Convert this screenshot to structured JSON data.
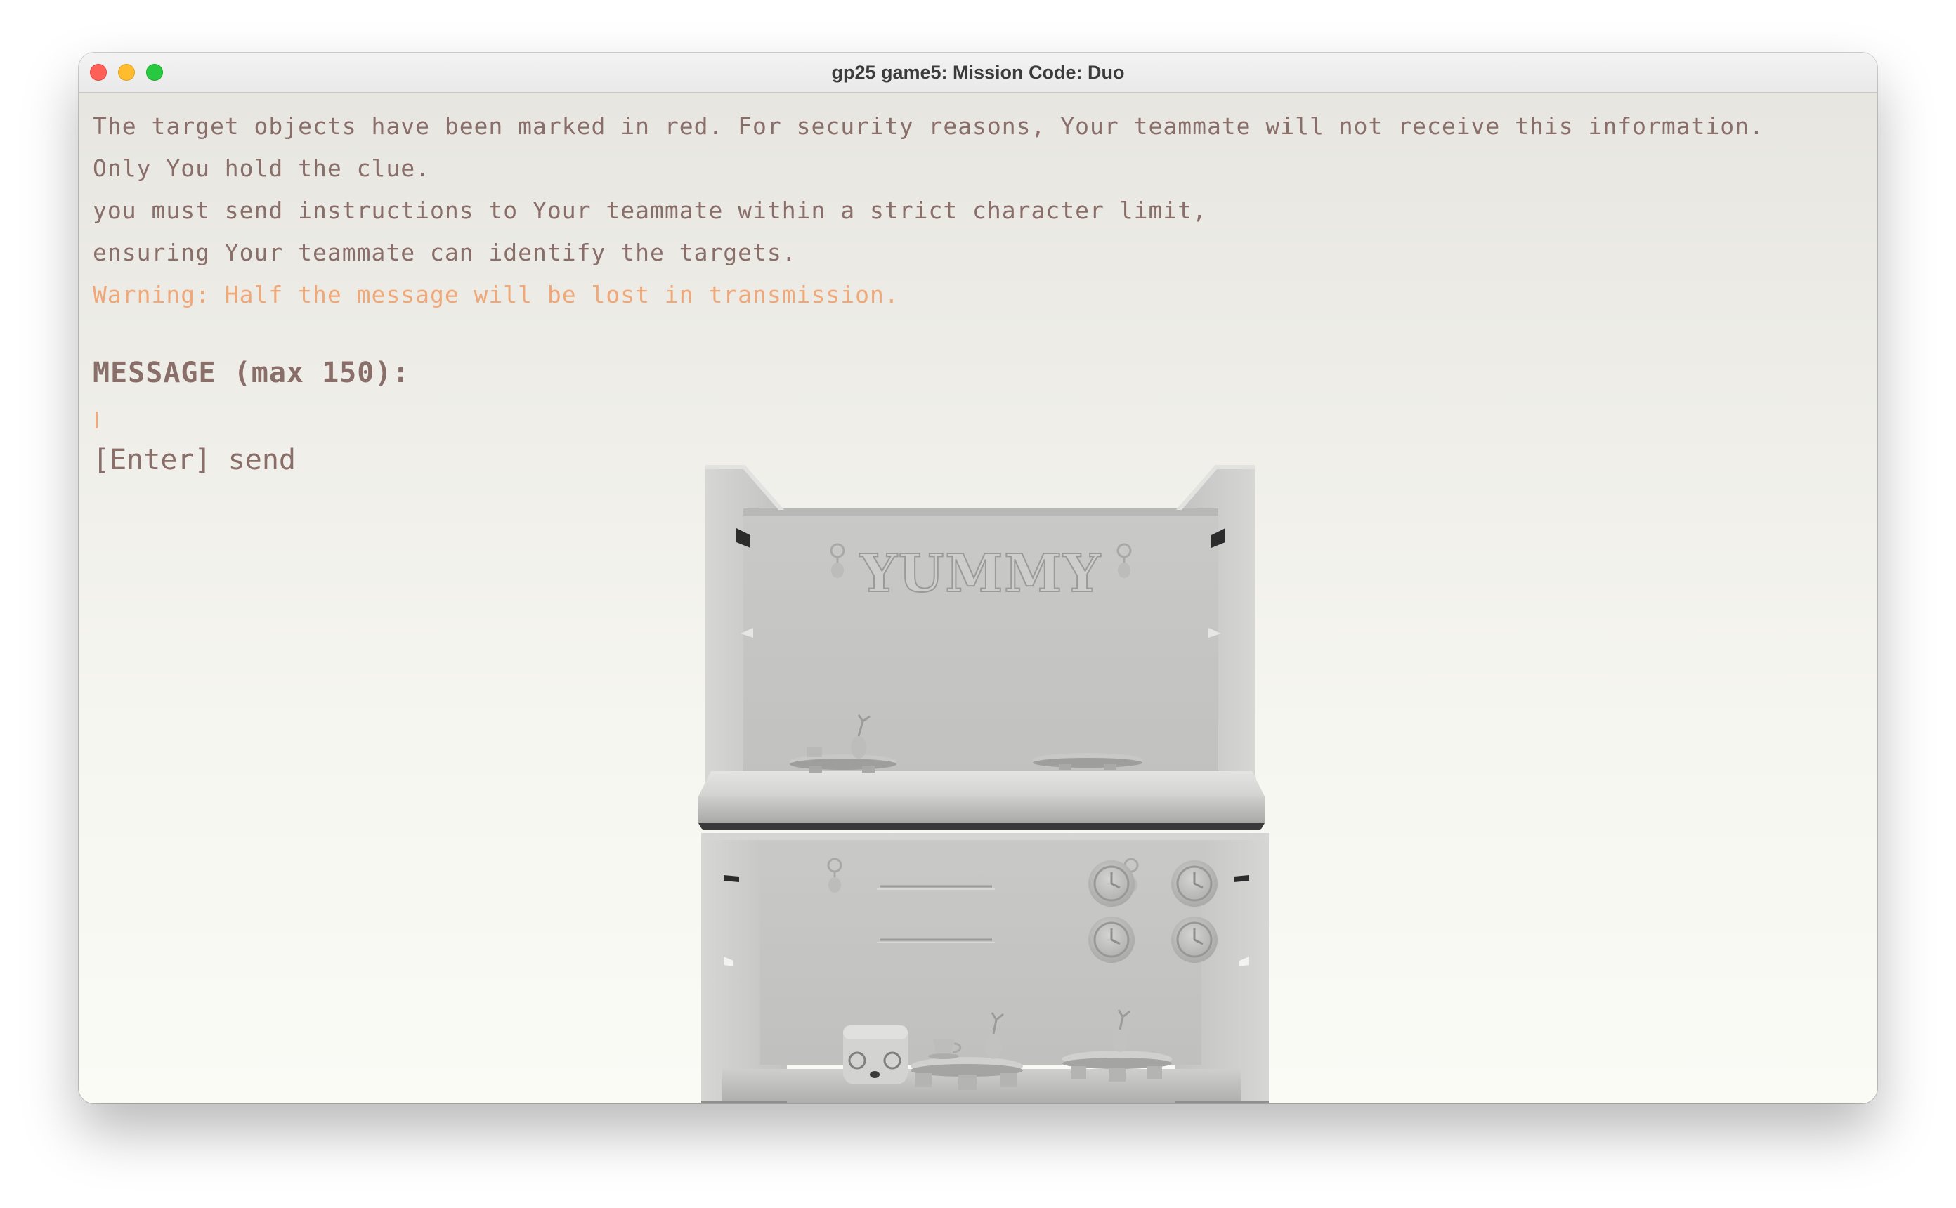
{
  "window": {
    "title": "gp25 game5: Mission Code: Duo"
  },
  "briefing": {
    "lines": [
      "The target objects have been marked in red. For security reasons, Your teammate will not receive this information.",
      "Only You hold the clue.",
      "you must send instructions to Your teammate within a strict character limit,",
      "ensuring Your teammate can identify the targets."
    ],
    "warning": "Warning: Half the message will be lost in transmission."
  },
  "message": {
    "label": "MESSAGE (max 150):",
    "value": "",
    "send_hint": "[Enter] send"
  },
  "scene": {
    "sign_text": "YUMMY"
  },
  "colors": {
    "text": "#8a6e6a",
    "warning": "#f0a878",
    "model": "#c4c4c2"
  }
}
